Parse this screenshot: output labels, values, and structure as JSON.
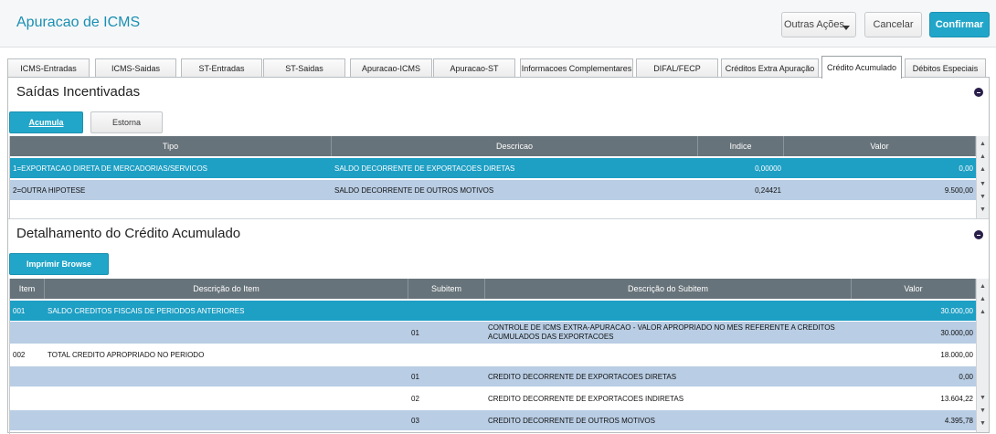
{
  "header": {
    "title": "Apuracao de ICMS",
    "buttons": {
      "more_actions": "Outras Ações",
      "cancel": "Cancelar",
      "confirm": "Confirmar"
    }
  },
  "tabs": [
    "ICMS-Entradas",
    "ICMS-Saidas",
    "ST-Entradas",
    "ST-Saidas",
    "Apuracao-ICMS",
    "Apuracao-ST",
    "Informacoes Complementares",
    "DIFAL/FECP",
    "Créditos Extra Apuração",
    "Crédito Acumulado",
    "Débitos Especiais"
  ],
  "active_tab": "Crédito Acumulado",
  "saidas": {
    "title": "Saídas Incentivadas",
    "buttons": {
      "accumulate": "Acumula",
      "reverse": "Estorna"
    },
    "columns": [
      "Tipo",
      "Descricao",
      "Indice",
      "Valor"
    ],
    "rows": [
      {
        "tipo": "1=EXPORTACAO DIRETA DE MERCADORIAS/SERVICOS",
        "descricao": "SALDO DECORRENTE DE EXPORTACOES DIRETAS",
        "indice": "0,00000",
        "valor": "0,00",
        "selected": true
      },
      {
        "tipo": "2=OUTRA HIPOTESE",
        "descricao": "SALDO DECORRENTE DE OUTROS MOTIVOS",
        "indice": "0,24421",
        "valor": "9.500,00",
        "selected": false
      }
    ]
  },
  "detalhamento": {
    "title": "Detalhamento do Crédito Acumulado",
    "buttons": {
      "print": "Imprimir Browse"
    },
    "columns": [
      "Item",
      "Descrição do Item",
      "Subitem",
      "Descrição do Subitem",
      "Valor"
    ],
    "rows": [
      {
        "item": "001",
        "desc_item": "SALDO CREDITOS FISCAIS DE PERIODOS ANTERIORES",
        "subitem": "",
        "desc_subitem": "",
        "valor": "30.000,00"
      },
      {
        "item": "",
        "desc_item": "",
        "subitem": "01",
        "desc_subitem": "CONTROLE DE ICMS EXTRA-APURACAO - VALOR APROPRIADO NO MES REFERENTE A CREDITOS ACUMULADOS DAS EXPORTACOES",
        "valor": "30.000,00"
      },
      {
        "item": "002",
        "desc_item": "TOTAL CREDITO APROPRIADO NO PERIODO",
        "subitem": "",
        "desc_subitem": "",
        "valor": "18.000,00"
      },
      {
        "item": "",
        "desc_item": "",
        "subitem": "01",
        "desc_subitem": "CREDITO DECORRENTE DE EXPORTACOES DIRETAS",
        "valor": "0,00"
      },
      {
        "item": "",
        "desc_item": "",
        "subitem": "02",
        "desc_subitem": "CREDITO DECORRENTE DE EXPORTACOES INDIRETAS",
        "valor": "13.604,22"
      },
      {
        "item": "",
        "desc_item": "",
        "subitem": "03",
        "desc_subitem": "CREDITO DECORRENTE DE OUTROS MOTIVOS",
        "valor": "4.395,78"
      }
    ]
  },
  "colors": {
    "accent": "#21a6c9",
    "selected_row": "#1e9fc4",
    "alt_row": "#b9cde4",
    "grid_header": "#67737a"
  }
}
